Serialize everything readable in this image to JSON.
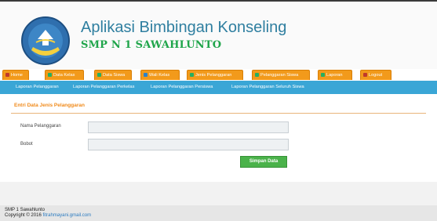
{
  "header": {
    "app_title": "Aplikasi Bimbingan Konseling",
    "school_name": "SMP N 1 SAWAHLUNTO",
    "logo_icon": "school-crest-icon"
  },
  "nav": {
    "tabs": [
      {
        "label": "Home",
        "icon": "home-icon",
        "icon_color": "#c0392b"
      },
      {
        "label": "Data Kelas",
        "icon": "class-icon",
        "icon_color": "#27ae60"
      },
      {
        "label": "Data Siswa",
        "icon": "student-icon",
        "icon_color": "#27ae60"
      },
      {
        "label": "Wali Kelas",
        "icon": "teacher-icon",
        "icon_color": "#2c82c9"
      },
      {
        "label": "Jenis Pelanggaran",
        "icon": "violation-type-icon",
        "icon_color": "#27ae60"
      },
      {
        "label": "Pelanggaran Siswa",
        "icon": "student-violation-icon",
        "icon_color": "#27ae60"
      },
      {
        "label": "Laporan",
        "icon": "report-icon",
        "icon_color": "#27ae60"
      },
      {
        "label": "Logout",
        "icon": "logout-icon",
        "icon_color": "#c0392b"
      }
    ],
    "tab_color": "#f29a1b"
  },
  "subnav": {
    "items": [
      {
        "label": "Laporan Pelanggaran"
      },
      {
        "label": "Laporan Pelanggaran Perkelas"
      },
      {
        "label": "Laporan Pelanggaran Persiswa"
      },
      {
        "label": "Laporan Pelanggaran Seluruh Siswa"
      }
    ],
    "bar_color": "#3aa6d6"
  },
  "form": {
    "title": "Entri Data Jenis Pelanggaran",
    "fields": [
      {
        "label": "Nama Pelanggaran",
        "value": "",
        "placeholder": ""
      },
      {
        "label": "Bobot",
        "value": "",
        "placeholder": ""
      }
    ],
    "submit_label": "Simpan Data",
    "submit_color": "#4ab24a"
  },
  "footer": {
    "line1": "SMP 1 Sawahlunto",
    "line2_prefix": "Copyright © 2016",
    "line2_link": "fitrahmayani.gmail.com"
  }
}
